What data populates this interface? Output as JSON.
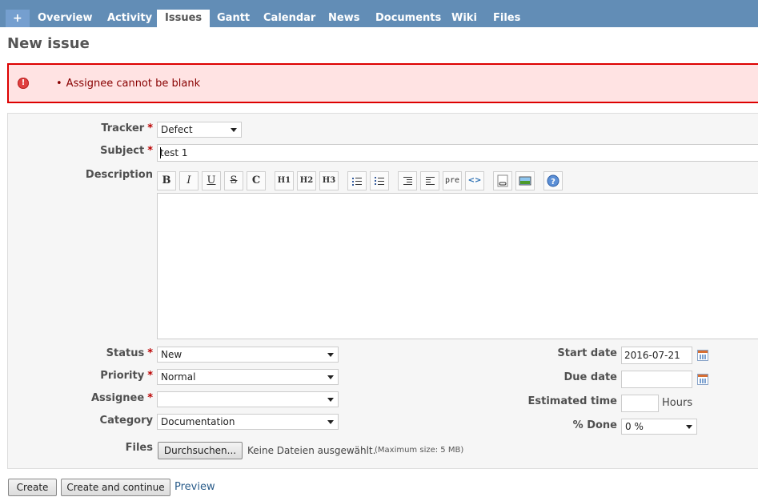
{
  "menu": {
    "tabs": [
      {
        "label": "+"
      },
      {
        "label": "Overview"
      },
      {
        "label": "Activity"
      },
      {
        "label": "Issues",
        "selected": true
      },
      {
        "label": "Gantt"
      },
      {
        "label": "Calendar"
      },
      {
        "label": "News"
      },
      {
        "label": "Documents"
      },
      {
        "label": "Wiki"
      },
      {
        "label": "Files"
      }
    ],
    "bar_color": "#628db6"
  },
  "page_title": "New issue",
  "error": {
    "icon": "exclamation-icon",
    "glyph": "!",
    "message": "Assignee cannot be blank",
    "color": "#880000"
  },
  "form": {
    "tracker": {
      "label": "Tracker",
      "required": "*",
      "value": "Defect"
    },
    "subject": {
      "label": "Subject",
      "required": "*",
      "value": "test 1"
    },
    "description": {
      "label": "Description",
      "toolbar": [
        {
          "name": "bold-button",
          "glyph": "B"
        },
        {
          "name": "italic-button",
          "glyph": "I"
        },
        {
          "name": "underline-button",
          "glyph": "U"
        },
        {
          "name": "strikethrough-button",
          "glyph": "S"
        },
        {
          "name": "code-button",
          "glyph": "C"
        },
        {
          "name": "heading1-button",
          "glyph": "H1"
        },
        {
          "name": "heading2-button",
          "glyph": "H2"
        },
        {
          "name": "heading3-button",
          "glyph": "H3"
        },
        {
          "name": "unordered-list-button",
          "glyph": ""
        },
        {
          "name": "ordered-list-button",
          "glyph": ""
        },
        {
          "name": "quote-button",
          "glyph": ""
        },
        {
          "name": "unquote-button",
          "glyph": ""
        },
        {
          "name": "preformatted-button",
          "glyph": "pre"
        },
        {
          "name": "code-highlight-button",
          "glyph": "<>"
        },
        {
          "name": "link-button",
          "glyph": ""
        },
        {
          "name": "image-button",
          "glyph": ""
        },
        {
          "name": "help-button",
          "glyph": "?"
        }
      ]
    },
    "status": {
      "label": "Status",
      "required": "*",
      "value": "New"
    },
    "priority": {
      "label": "Priority",
      "required": "*",
      "value": "Normal"
    },
    "assignee": {
      "label": "Assignee",
      "required": "*",
      "value": ""
    },
    "category": {
      "label": "Category",
      "value": "Documentation"
    },
    "start_date": {
      "label": "Start date",
      "value": "2016-07-21"
    },
    "due_date": {
      "label": "Due date",
      "value": ""
    },
    "estimated_time": {
      "label": "Estimated time",
      "value": "",
      "unit": "Hours"
    },
    "done_ratio": {
      "label": "% Done",
      "value": "0 %"
    },
    "files": {
      "label": "Files",
      "browse_label": "Durchsuchen...",
      "no_file": "Keine Dateien ausgewählt.",
      "max_size": "(Maximum size: 5 MB)"
    }
  },
  "actions": {
    "create": "Create",
    "create_continue": "Create and continue",
    "preview": "Preview"
  }
}
